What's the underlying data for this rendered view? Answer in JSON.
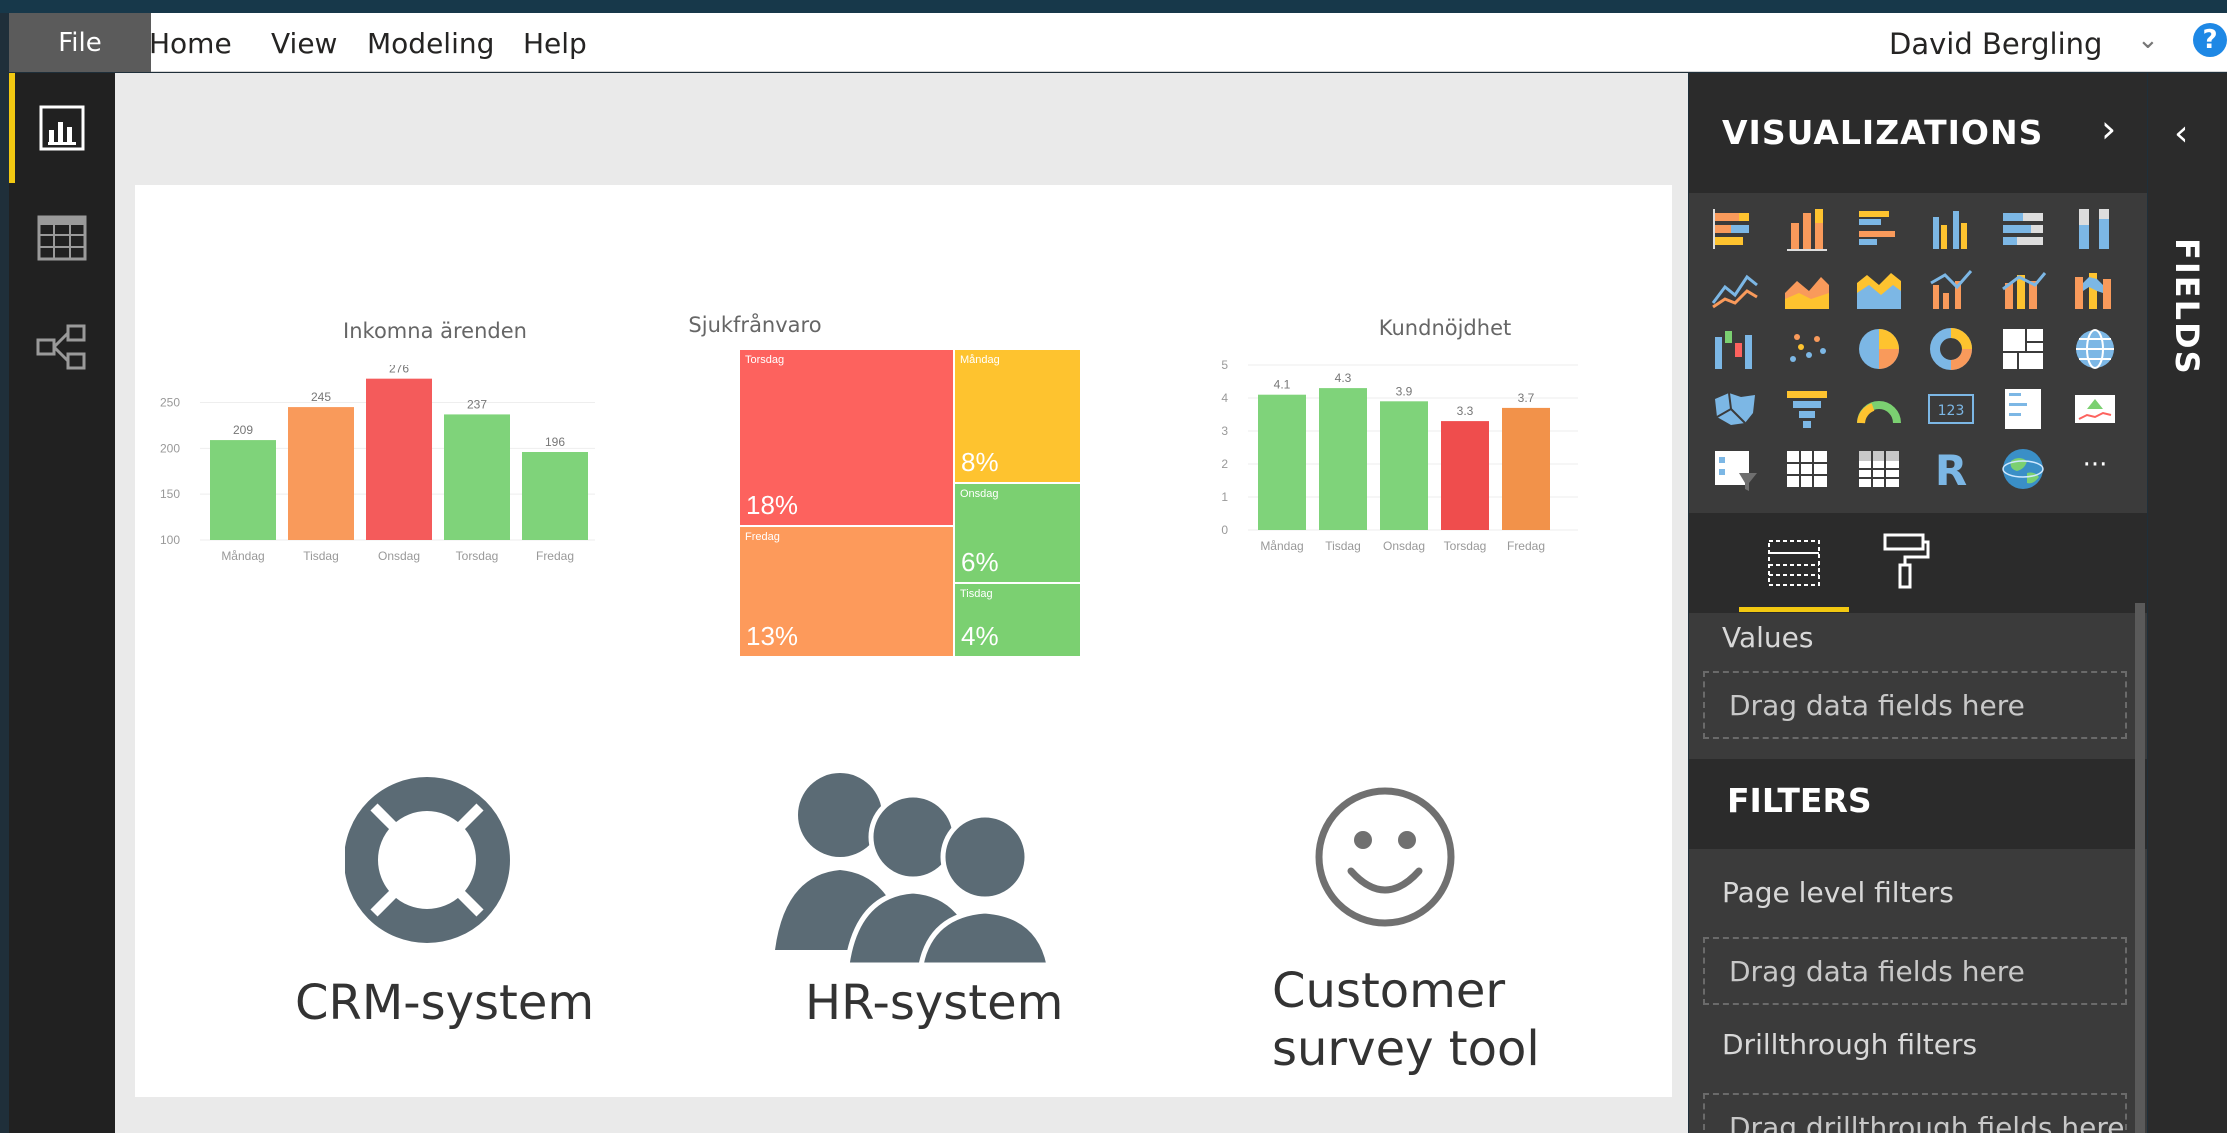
{
  "menubar": {
    "file": "File",
    "items": [
      "Home",
      "View",
      "Modeling",
      "Help"
    ],
    "user": "David Bergling",
    "help": "?"
  },
  "charts": {
    "incoming": {
      "title": "Inkomna ärenden",
      "yticks": [
        "250",
        "200",
        "150",
        "100"
      ],
      "categories": [
        "Måndag",
        "Tisdag",
        "Onsdag",
        "Torsdag",
        "Fredag"
      ],
      "values": [
        209,
        245,
        276,
        237,
        196
      ],
      "colors": [
        "#7fd37a",
        "#f99a5b",
        "#f45b5b",
        "#7fd37a",
        "#7fd37a"
      ]
    },
    "sick": {
      "title": "Sjukfrånvaro",
      "tiles": [
        {
          "label": "Torsdag",
          "pct": "18%",
          "color": "#fd625e"
        },
        {
          "label": "Måndag",
          "pct": "8%",
          "color": "#fec32f"
        },
        {
          "label": "Onsdag",
          "pct": "6%",
          "color": "#7bd071"
        },
        {
          "label": "Fredag",
          "pct": "13%",
          "color": "#fd9a5b"
        },
        {
          "label": "Tisdag",
          "pct": "4%",
          "color": "#7bd071"
        }
      ]
    },
    "satisfaction": {
      "title": "Kundnöjdhet",
      "yticks": [
        "5",
        "4",
        "3",
        "2",
        "1",
        "0"
      ],
      "categories": [
        "Måndag",
        "Tisdag",
        "Onsdag",
        "Torsdag",
        "Fredag"
      ],
      "values": [
        4.1,
        4.3,
        3.9,
        3.3,
        3.7
      ],
      "colors": [
        "#7fd37a",
        "#7fd37a",
        "#7fd37a",
        "#ef4d4d",
        "#f2924a"
      ]
    }
  },
  "chart_data": [
    {
      "type": "bar",
      "title": "Inkomna ärenden",
      "categories": [
        "Måndag",
        "Tisdag",
        "Onsdag",
        "Torsdag",
        "Fredag"
      ],
      "values": [
        209,
        245,
        276,
        237,
        196
      ],
      "ylim": [
        100,
        280
      ]
    },
    {
      "type": "heatmap",
      "title": "Sjukfrånvaro",
      "categories": [
        "Torsdag",
        "Måndag",
        "Onsdag",
        "Fredag",
        "Tisdag"
      ],
      "values": [
        18,
        8,
        6,
        13,
        4
      ]
    },
    {
      "type": "bar",
      "title": "Kundnöjdhet",
      "categories": [
        "Måndag",
        "Tisdag",
        "Onsdag",
        "Torsdag",
        "Fredag"
      ],
      "values": [
        4.1,
        4.3,
        3.9,
        3.3,
        3.7
      ],
      "ylim": [
        0,
        5
      ]
    }
  ],
  "systems": {
    "crm": "CRM-system",
    "hr": "HR-system",
    "survey_line1": "Customer",
    "survey_line2": "survey tool"
  },
  "visualizations": {
    "title": "VISUALIZATIONS",
    "values_label": "Values",
    "values_drop": "Drag data fields here",
    "filters_title": "FILTERS",
    "page_filters": "Page level filters",
    "page_drop": "Drag data fields here",
    "drill_label": "Drillthrough filters",
    "drill_drop": "Drag drillthrough fields here",
    "r_icon": "R",
    "more_icon": "···",
    "num_icon": "123"
  },
  "fields": {
    "title": "FIELDS"
  }
}
